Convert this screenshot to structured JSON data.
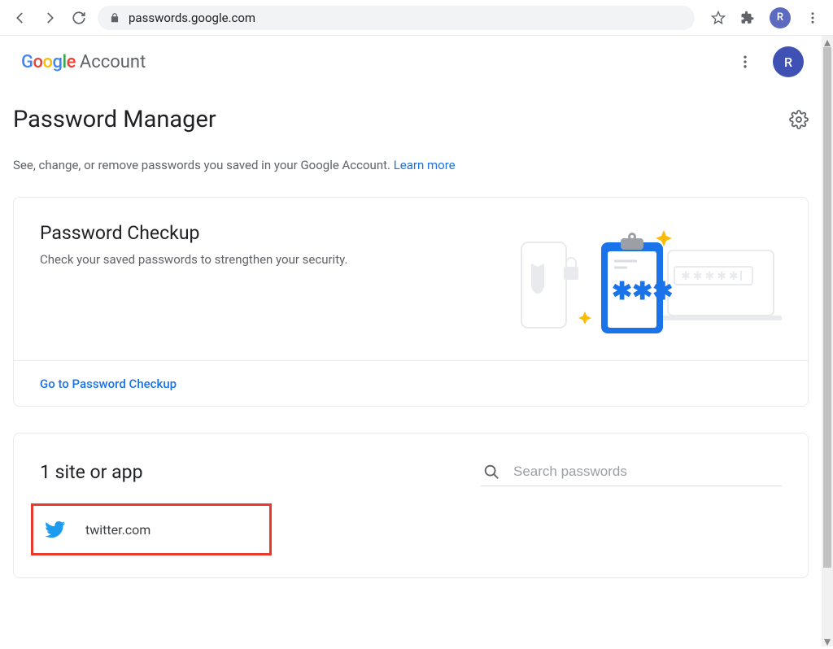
{
  "browser": {
    "url": "passwords.google.com",
    "avatar_initial": "R"
  },
  "header": {
    "logo_text": "Google",
    "account_text": "Account",
    "avatar_initial": "R"
  },
  "page": {
    "title": "Password Manager",
    "subtitle_prefix": "See, change, or remove passwords you saved in your Google Account. ",
    "learn_more": "Learn more"
  },
  "checkup": {
    "title": "Password Checkup",
    "desc": "Check your saved passwords to strengthen your security.",
    "cta": "Go to Password Checkup"
  },
  "sites": {
    "count_label": "1 site or app",
    "search_placeholder": "Search passwords",
    "items": [
      {
        "name": "twitter.com",
        "icon": "twitter-icon"
      }
    ]
  }
}
